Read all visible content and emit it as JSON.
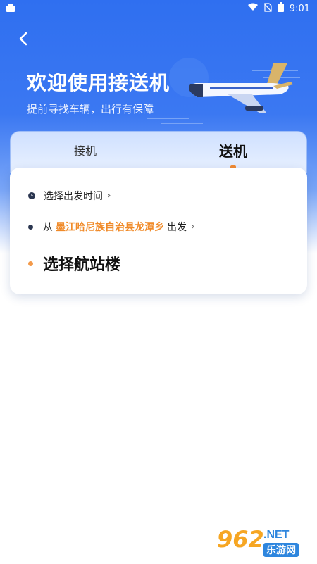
{
  "status_bar": {
    "time": "9:01"
  },
  "hero": {
    "title": "欢迎使用接送机",
    "subtitle": "提前寻找车辆，出行有保障"
  },
  "tabs": [
    {
      "label": "接机",
      "active": false
    },
    {
      "label": "送机",
      "active": true
    }
  ],
  "form": {
    "time_label": "选择出发时间",
    "from_prefix": "从",
    "origin": "墨江哈尼族自治县龙潭乡",
    "from_suffix": "出发",
    "terminal_label": "选择航站楼"
  },
  "watermark": {
    "number": "962",
    "net": ".NET",
    "cn": "乐游网"
  },
  "colors": {
    "accent_blue": "#2f6ff0",
    "accent_orange": "#f08a28"
  }
}
